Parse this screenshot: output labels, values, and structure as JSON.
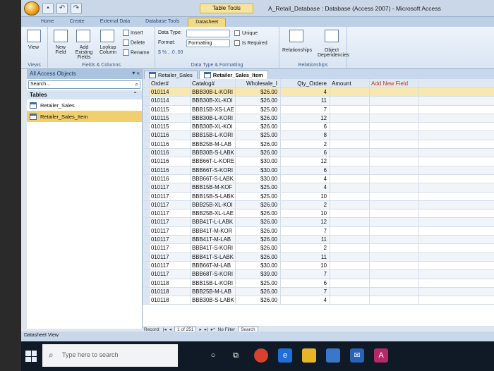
{
  "window": {
    "contextual_tab_group": "Table Tools",
    "title": "A_Retail_Database : Database (Access 2007) - Microsoft Access"
  },
  "ribbon_tabs": [
    "Home",
    "Create",
    "External Data",
    "Database Tools",
    "Datasheet"
  ],
  "active_tab": "Datasheet",
  "ribbon": {
    "views": {
      "label": "View",
      "group": "Views"
    },
    "fields_columns": {
      "new_field": "New Field",
      "add_existing": "Add Existing Fields",
      "lookup_column": "Lookup Column",
      "insert": "Insert",
      "delete": "Delete",
      "rename": "Rename",
      "group": "Fields & Columns"
    },
    "data_type_formatting": {
      "data_type_label": "Data Type:",
      "format_label": "Format:",
      "format_value": "Formatting",
      "unique": "Unique",
      "is_required": "Is Required",
      "group": "Data Type & Formatting"
    },
    "relationships": {
      "relationships": "Relationships",
      "object_dependencies": "Object Dependencies",
      "group": "Relationships"
    }
  },
  "nav_pane": {
    "title": "All Access Objects",
    "search_placeholder": "Search...",
    "group": "Tables",
    "items": [
      "Retailer_Sales",
      "Retailer_Sales_Item"
    ]
  },
  "doc_tabs": [
    "Retailer_Sales",
    "Retailer_Sales_Item"
  ],
  "active_doc_tab": "Retailer_Sales_Item",
  "grid": {
    "columns": [
      "Order#",
      "Catalog#",
      "Wholesale_I",
      "Qty_Ordere",
      "Amount",
      "Add New Field"
    ],
    "rows": [
      [
        "010114",
        "BBB30B-L-KORI",
        "$26.00",
        "4"
      ],
      [
        "010114",
        "BBB30B-XL-KOI",
        "$26.00",
        "11"
      ],
      [
        "010115",
        "BBB15B-XS-LAE",
        "$25.00",
        "7"
      ],
      [
        "010115",
        "BBB30B-L-KORI",
        "$26.00",
        "12"
      ],
      [
        "010115",
        "BBB30B-XL-KOI",
        "$26.00",
        "6"
      ],
      [
        "010116",
        "BBB15B-L-KORI",
        "$25.00",
        "8"
      ],
      [
        "010116",
        "BBB25B-M-LAB",
        "$26.00",
        "2"
      ],
      [
        "010116",
        "BBB30B-S-LABK",
        "$26.00",
        "6"
      ],
      [
        "010116",
        "BBB66T-L-KORE",
        "$30.00",
        "12"
      ],
      [
        "010116",
        "BBB66T-S-KORI",
        "$30.00",
        "6"
      ],
      [
        "010116",
        "BBB66T-S-LABK",
        "$30.00",
        "4"
      ],
      [
        "010117",
        "BBB15B-M-KOF",
        "$25.00",
        "4"
      ],
      [
        "010117",
        "BBB15B-S-LABK",
        "$25.00",
        "10"
      ],
      [
        "010117",
        "BBB25B-XL-KOI",
        "$26.00",
        "2"
      ],
      [
        "010117",
        "BBB25B-XL-LAE",
        "$26.00",
        "10"
      ],
      [
        "010117",
        "BBB41T-L-LABK",
        "$26.00",
        "12"
      ],
      [
        "010117",
        "BBB41T-M-KOR",
        "$26.00",
        "7"
      ],
      [
        "010117",
        "BBB41T-M-LAB",
        "$26.00",
        "11"
      ],
      [
        "010117",
        "BBB41T-S-KORI",
        "$26.00",
        "2"
      ],
      [
        "010117",
        "BBB41T-S-LABK",
        "$26.00",
        "11"
      ],
      [
        "010117",
        "BBB66T-M-LAB",
        "$30.00",
        "10"
      ],
      [
        "010117",
        "BBB68T-S-KORI",
        "$39.00",
        "7"
      ],
      [
        "010118",
        "BBB15B-L-KORI",
        "$25.00",
        "6"
      ],
      [
        "010118",
        "BBB25B-M-LAB",
        "$26.00",
        "7"
      ],
      [
        "010118",
        "BBB30B-S-LABK",
        "$26.00",
        "4"
      ]
    ]
  },
  "record_nav": {
    "label": "Record:",
    "position": "1 of 251",
    "filter": "No Filter",
    "search": "Search"
  },
  "status": "Datasheet View",
  "taskbar": {
    "search_placeholder": "Type here to search"
  }
}
